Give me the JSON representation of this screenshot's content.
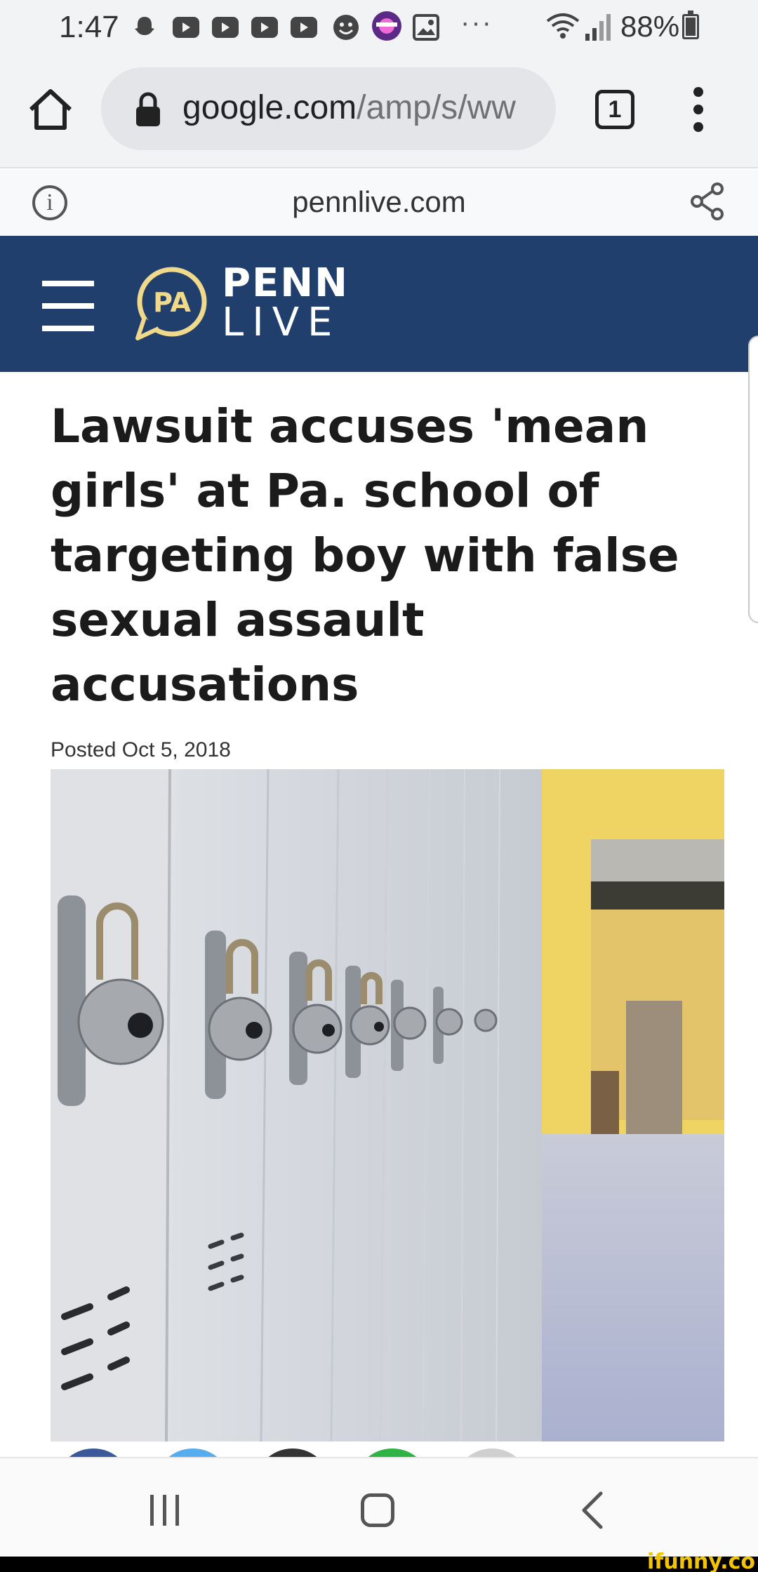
{
  "status_bar": {
    "time": "1:47",
    "more": "···",
    "battery": "88%",
    "icons": [
      "snapchat-icon",
      "youtube-icon",
      "youtube-icon",
      "youtube-icon",
      "youtube-icon",
      "emoji-icon",
      "app-icon",
      "gallery-icon",
      "wifi-icon",
      "signal-icon",
      "battery-icon"
    ]
  },
  "browser": {
    "url_host": "google.com",
    "url_path": "/amp/s/ww",
    "tab_count": "1"
  },
  "amp_header": {
    "domain": "pennlive.com"
  },
  "site": {
    "logo_text": "PA",
    "brand_line1": "PENN",
    "brand_line2": "LIVE",
    "brand_color": "#213f6c",
    "accent_color": "#f0d98a"
  },
  "article": {
    "headline": "Lawsuit accuses 'mean girls' at Pa. school of targeting boy with false sexual assault accusations",
    "posted": "Posted Oct 5, 2018"
  },
  "watermark": "ifunny.co"
}
